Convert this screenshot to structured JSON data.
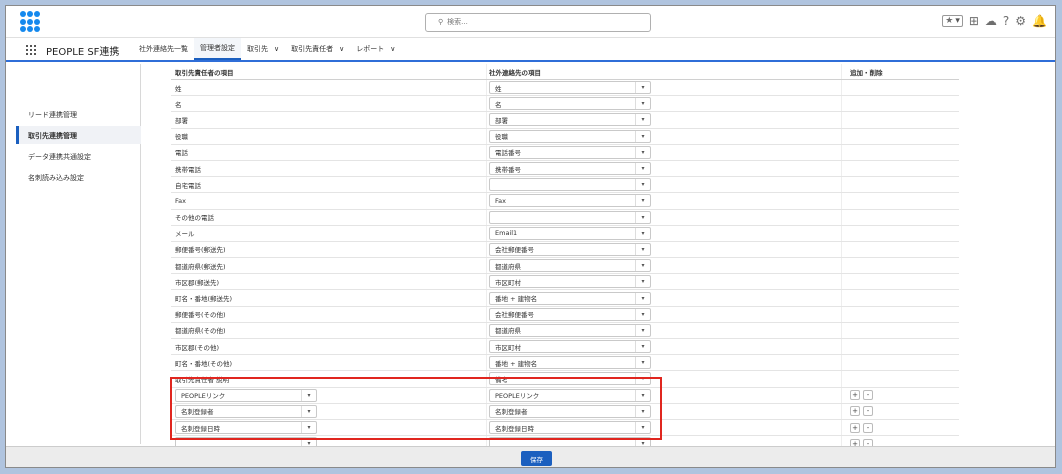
{
  "header": {
    "search_placeholder": "検索..."
  },
  "nav": {
    "app_name": "PEOPLE SF連携",
    "items": [
      {
        "label": "社外連絡先一覧",
        "chevron": false
      },
      {
        "label": "管理者設定",
        "chevron": false
      },
      {
        "label": "取引先",
        "chevron": true
      },
      {
        "label": "取引先責任者",
        "chevron": true
      },
      {
        "label": "レポート",
        "chevron": true
      }
    ],
    "active_index": 1
  },
  "sidebar": {
    "items": [
      {
        "label": "リード連携管理"
      },
      {
        "label": "取引先連携管理"
      },
      {
        "label": "データ連携共通設定"
      },
      {
        "label": "名刺読み込み設定"
      }
    ],
    "selected_index": 1
  },
  "table": {
    "headers": [
      "取引先責任者の項目",
      "社外連絡先の項目",
      "追加・削除"
    ],
    "rows": [
      {
        "left": "姓",
        "right": "姓"
      },
      {
        "left": "名",
        "right": "名"
      },
      {
        "left": "部署",
        "right": "部署"
      },
      {
        "left": "役職",
        "right": "役職"
      },
      {
        "left": "電話",
        "right": "電話番号"
      },
      {
        "left": "携帯電話",
        "right": "携帯番号"
      },
      {
        "left": "自宅電話",
        "right": ""
      },
      {
        "left": "Fax",
        "right": "Fax"
      },
      {
        "left": "その他の電話",
        "right": ""
      },
      {
        "left": "メール",
        "right": "Email1"
      },
      {
        "left": "郵便番号(郵送先)",
        "right": "会社郵便番号"
      },
      {
        "left": "都道府県(郵送先)",
        "right": "都道府県"
      },
      {
        "left": "市区郡(郵送先)",
        "right": "市区町村"
      },
      {
        "left": "町名・番地(郵送先)",
        "right": "番地 + 建物名"
      },
      {
        "left": "郵便番号(その他)",
        "right": "会社郵便番号"
      },
      {
        "left": "都道府県(その他)",
        "right": "都道府県"
      },
      {
        "left": "市区郡(その他)",
        "right": "市区町村"
      },
      {
        "left": "町名・番地(その他)",
        "right": "番地 + 建物名"
      },
      {
        "left": "取引先責任者 説明",
        "right": "備考"
      }
    ],
    "custom_rows": [
      {
        "left": "PEOPLEリンク",
        "right": "PEOPLEリンク"
      },
      {
        "left": "名刺登録者",
        "right": "名刺登録者"
      },
      {
        "left": "名刺登録日時",
        "right": "名刺登録日時"
      },
      {
        "left": "",
        "right": ""
      }
    ],
    "add_label": "+",
    "remove_label": "-"
  },
  "footer": {
    "save_label": "保存"
  },
  "colors": {
    "accent": "#1b5fbf",
    "highlight": "#e0261f"
  }
}
